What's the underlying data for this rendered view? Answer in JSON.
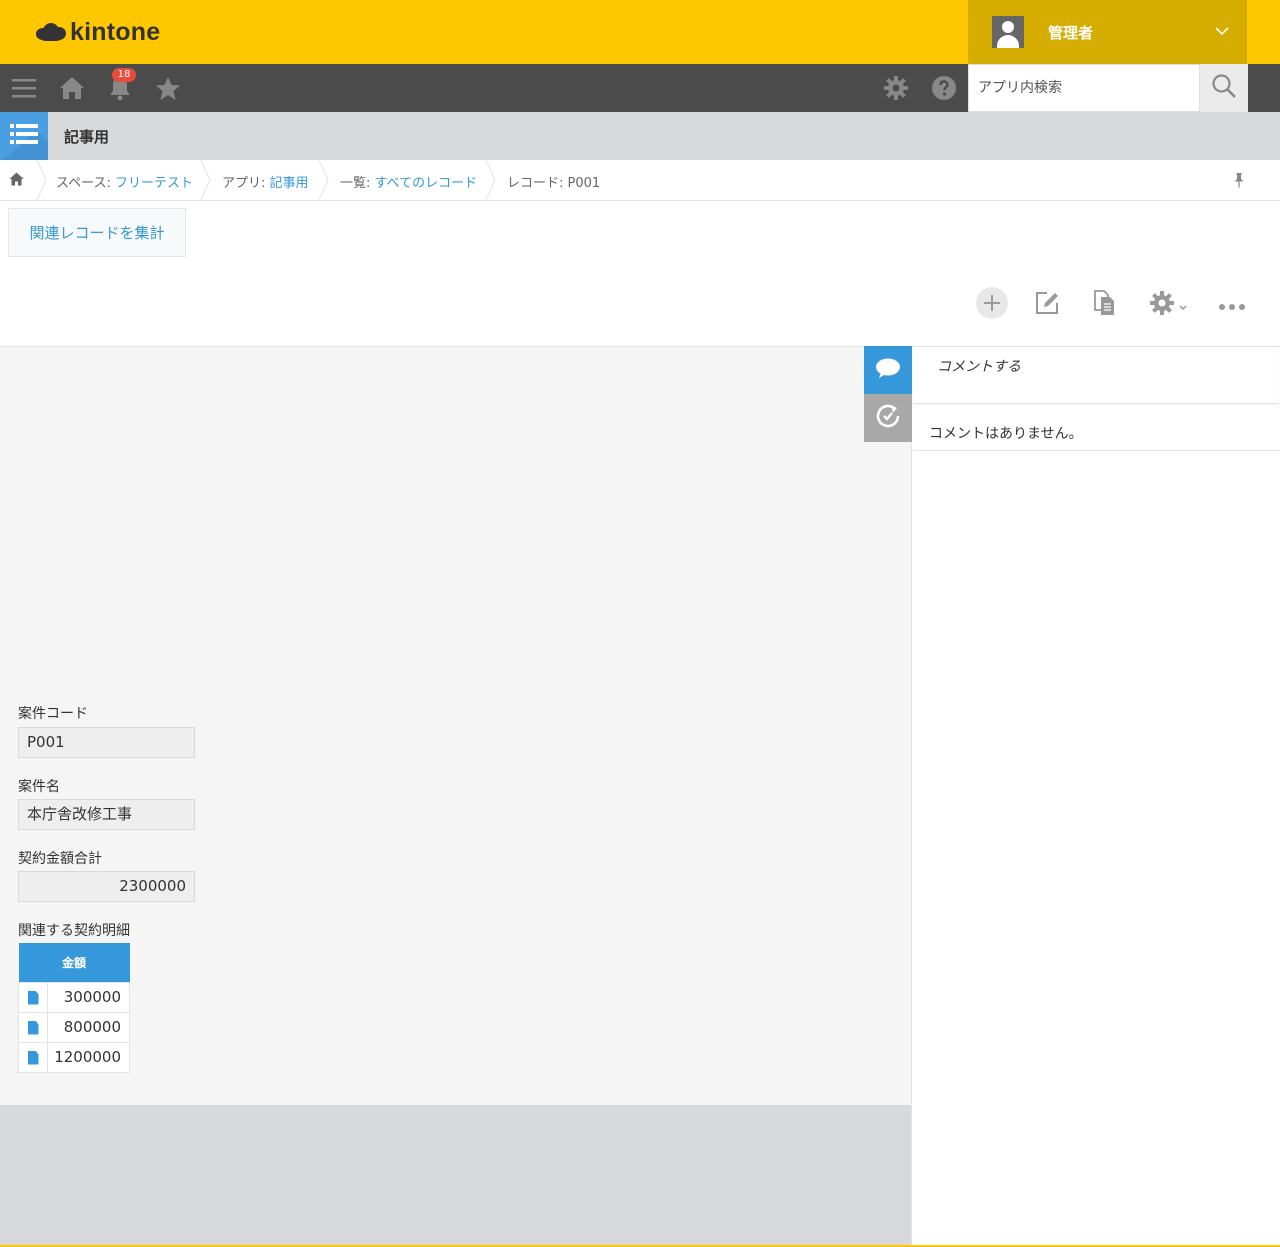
{
  "header": {
    "logo_text": "kintone",
    "user_name": "管理者",
    "brand_color": "#ffc700"
  },
  "toolbar": {
    "notification_count": "18",
    "search_placeholder": "アプリ内検索",
    "icons": [
      "menu-icon",
      "home-icon",
      "bell-icon",
      "star-icon",
      "gear-icon",
      "help-icon",
      "search-icon"
    ]
  },
  "app": {
    "title": "記事用"
  },
  "breadcrumb": {
    "space_label": "スペース: ",
    "space_link": "フリーテスト",
    "app_label": "アプリ: ",
    "app_link": "記事用",
    "view_label": "一覧: ",
    "view_link": "すべてのレコード",
    "record_label": "レコード: P001"
  },
  "actions": {
    "aggregate_button": "関連レコードを集計"
  },
  "record": {
    "fields": [
      {
        "label": "案件コード",
        "value": "P001"
      },
      {
        "label": "案件名",
        "value": "本庁舎改修工事"
      },
      {
        "label": "契約金額合計",
        "value": "2300000"
      }
    ],
    "subtable": {
      "label": "関連する契約明細",
      "header": "金額",
      "rows": [
        "300000",
        "800000",
        "1200000"
      ]
    }
  },
  "comments": {
    "input_placeholder": "コメントする",
    "empty_text": "コメントはありません。"
  }
}
